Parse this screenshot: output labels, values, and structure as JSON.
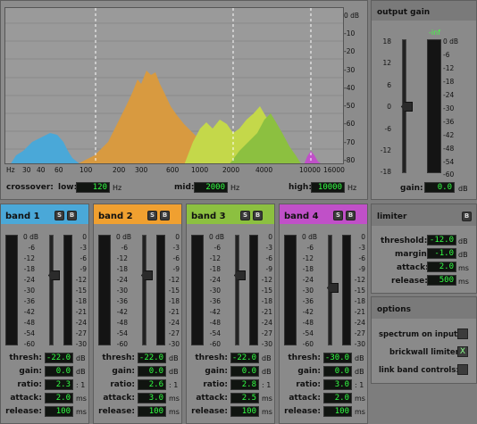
{
  "spectrum": {
    "db_labels": [
      "0 dB",
      "-10",
      "-20",
      "-30",
      "-40",
      "-50",
      "-60",
      "-70",
      "-80"
    ],
    "freq_labels": [
      "Hz",
      "30",
      "40",
      "60",
      "100",
      "200",
      "300",
      "600",
      "1000",
      "2000",
      "4000",
      "10000",
      "16000"
    ]
  },
  "crossover": {
    "label": "crossover:",
    "low_label": "low:",
    "low_value": "120",
    "low_unit": "Hz",
    "mid_label": "mid:",
    "mid_value": "2000",
    "mid_unit": "Hz",
    "high_label": "high:",
    "high_value": "10000",
    "high_unit": "Hz"
  },
  "output_gain": {
    "title": "output gain",
    "meter_top": "-inf",
    "fader_scale": [
      "18",
      "12",
      "6",
      "0",
      "-6",
      "-12",
      "-18"
    ],
    "meter_scale": [
      "0 dB",
      "-6",
      "-12",
      "-18",
      "-24",
      "-30",
      "-36",
      "-42",
      "-48",
      "-54",
      "-60"
    ],
    "gain_label": "gain:",
    "gain_value": "0.0",
    "gain_unit": "dB"
  },
  "limiter": {
    "title": "limiter",
    "button": "B",
    "threshold_label": "threshold:",
    "threshold_value": "-12.0",
    "threshold_unit": "dB",
    "margin_label": "margin:",
    "margin_value": "-1.0",
    "margin_unit": "dB",
    "attack_label": "attack:",
    "attack_value": "2.0",
    "attack_unit": "ms",
    "release_label": "release:",
    "release_value": "500",
    "release_unit": "ms"
  },
  "options": {
    "title": "options",
    "spectrum_label": "spectrum on input:",
    "spectrum_value": "",
    "brickwall_label": "brickwall limiter:",
    "brickwall_value": "X",
    "link_label": "link band controls:",
    "link_value": ""
  },
  "band_common": {
    "solo": "S",
    "bypass": "B",
    "meter_scale": [
      "0 dB",
      "-6",
      "-12",
      "-18",
      "-24",
      "-30",
      "-36",
      "-42",
      "-48",
      "-54",
      "-60"
    ],
    "gr_scale": [
      "0",
      "-3",
      "-6",
      "-9",
      "-12",
      "-15",
      "-18",
      "-21",
      "-24",
      "-27",
      "-30"
    ],
    "thresh_label": "thresh:",
    "gain_label": "gain:",
    "ratio_label": "ratio:",
    "attack_label": "attack:",
    "release_label": "release:",
    "db": "dB",
    "ratio_unit": ": 1",
    "ms": "ms"
  },
  "bands": [
    {
      "name": "band 1",
      "color": "#4aa8d8",
      "thresh": "-22.0",
      "gain": "0.0",
      "ratio": "2.3",
      "attack": "2.0",
      "release": "100"
    },
    {
      "name": "band 2",
      "color": "#f0a030",
      "thresh": "-22.0",
      "gain": "0.0",
      "ratio": "2.6",
      "attack": "3.0",
      "release": "100"
    },
    {
      "name": "band 3",
      "color": "#8cc040",
      "thresh": "-22.0",
      "gain": "0.0",
      "ratio": "2.8",
      "attack": "2.5",
      "release": "100"
    },
    {
      "name": "band 4",
      "color": "#c050c8",
      "thresh": "-30.0",
      "gain": "0.0",
      "ratio": "3.0",
      "attack": "2.0",
      "release": "100"
    }
  ]
}
